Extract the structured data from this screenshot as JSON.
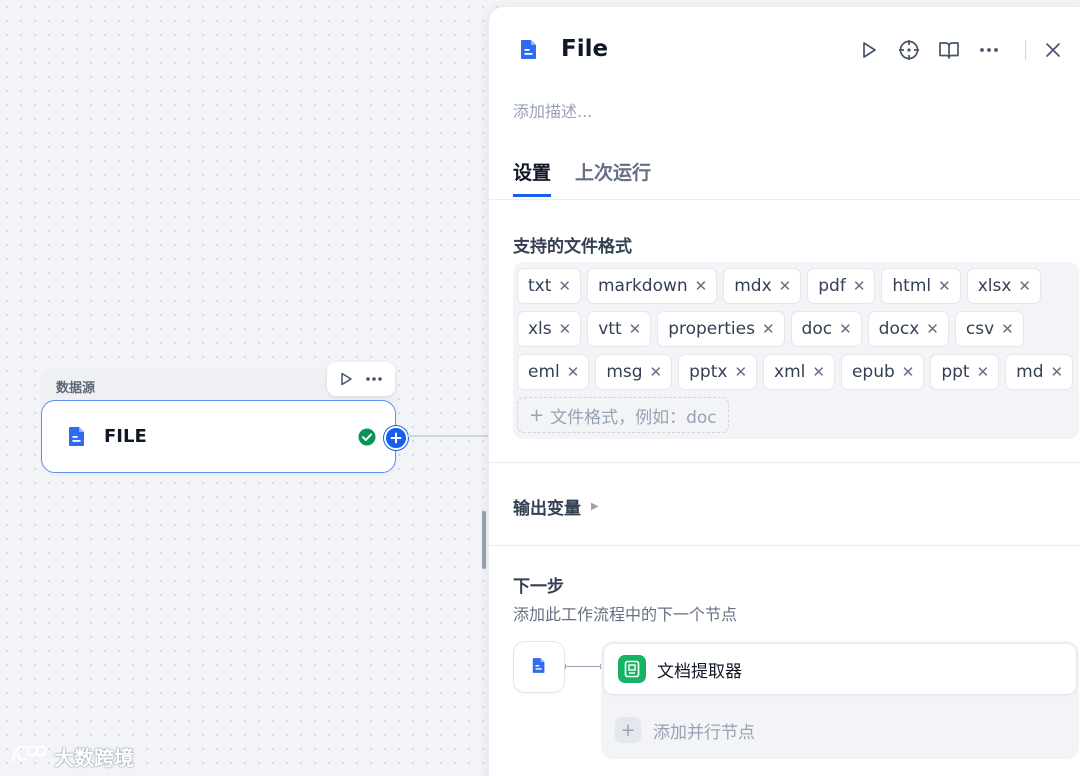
{
  "canvas": {
    "node": {
      "group_label": "数据源",
      "title": "FILE",
      "run_icon": "play-icon",
      "more_icon": "more-horizontal-icon",
      "status_icon": "check-circle-icon",
      "add_icon": "plus-circle-icon"
    },
    "watermark": "大数跨境"
  },
  "panel": {
    "title": "File",
    "icon": "file-icon",
    "tools": [
      "play-icon",
      "crosshair-icon",
      "book-icon",
      "more-horizontal-icon",
      "close-icon"
    ],
    "description_placeholder": "添加描述...",
    "tabs": [
      {
        "label": "设置",
        "active": true
      },
      {
        "label": "上次运行",
        "active": false
      }
    ],
    "formats": {
      "label": "支持的文件格式",
      "tags": [
        "txt",
        "markdown",
        "mdx",
        "pdf",
        "html",
        "xlsx",
        "xls",
        "vtt",
        "properties",
        "doc",
        "docx",
        "csv",
        "eml",
        "msg",
        "pptx",
        "xml",
        "epub",
        "ppt",
        "md"
      ],
      "add_placeholder": "文件格式，例如：doc"
    },
    "output": {
      "label": "输出变量"
    },
    "next_step": {
      "label": "下一步",
      "description": "添加此工作流程中的下一个节点",
      "node_name": "文档提取器",
      "add_parallel": "添加并行节点"
    }
  },
  "colors": {
    "accent": "#155eef",
    "success": "#16b364",
    "node_border": "#5c8ff0"
  }
}
